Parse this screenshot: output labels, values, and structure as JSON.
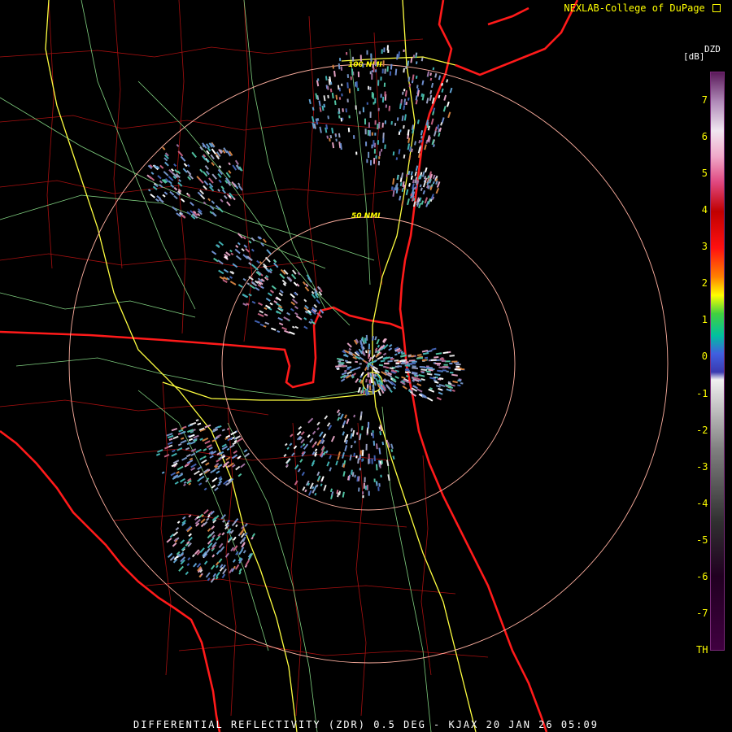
{
  "header": {
    "credit": "NEXLAB-College of DuPage",
    "credit_icon": "external-link-icon"
  },
  "legend": {
    "product": "DZD",
    "unit": "[dB]",
    "ticks": [
      "7",
      "6",
      "5",
      "4",
      "3",
      "2",
      "1",
      "0",
      "-1",
      "-2",
      "-3",
      "-4",
      "-5",
      "-6",
      "-7",
      "TH"
    ],
    "tick_values": [
      7,
      6,
      5,
      4,
      3,
      2,
      1,
      0,
      -1,
      -2,
      -3,
      -4,
      -5,
      -6,
      -7,
      -8
    ],
    "color_stops": [
      {
        "value": 7.8,
        "color": "#5a1a5a"
      },
      {
        "value": 7.0,
        "color": "#b08ab8"
      },
      {
        "value": 6.2,
        "color": "#f0e6f0"
      },
      {
        "value": 5.5,
        "color": "#f0a8c8"
      },
      {
        "value": 4.8,
        "color": "#e04880"
      },
      {
        "value": 4.0,
        "color": "#c00000"
      },
      {
        "value": 3.0,
        "color": "#ff1010"
      },
      {
        "value": 2.2,
        "color": "#ff8000"
      },
      {
        "value": 1.7,
        "color": "#ffff00"
      },
      {
        "value": 1.2,
        "color": "#40d040"
      },
      {
        "value": 0.6,
        "color": "#00c0a0"
      },
      {
        "value": 0.1,
        "color": "#4060e0"
      },
      {
        "value": -0.4,
        "color": "#3a3ab0"
      },
      {
        "value": -0.6,
        "color": "#f0f0f0"
      },
      {
        "value": -2.5,
        "color": "#808080"
      },
      {
        "value": -4.5,
        "color": "#303030"
      },
      {
        "value": -6.0,
        "color": "#200020"
      },
      {
        "value": -8.0,
        "color": "#400040"
      }
    ]
  },
  "map": {
    "radar_site": "KJAX",
    "range_rings": [
      {
        "label": "50 NMI",
        "nmi": 50
      },
      {
        "label": "100 NMI",
        "nmi": 100
      }
    ],
    "colors": {
      "state_border": "#ff1a1a",
      "county_border": "#b01010",
      "highway": "#ffff40",
      "road": "#80d080",
      "ring": "#ffb0a0"
    }
  },
  "footer": {
    "caption": "DIFFERENTIAL REFLECTIVITY (ZDR) 0.5 DEG - KJAX 20 JAN 26 05:09"
  }
}
